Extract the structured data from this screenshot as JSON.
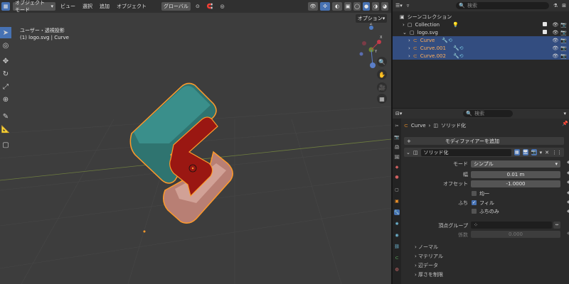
{
  "viewport": {
    "mode": "オブジェクトモード",
    "menus": [
      "ビュー",
      "選択",
      "追加",
      "オブジェクト"
    ],
    "transform": "グローバル",
    "options_label": "オプション",
    "view_name": "ユーザー・透視投影",
    "collection_info": "(1) logo.svg | Curve",
    "gizmo_axes": {
      "x": "X",
      "y": "Y",
      "z": "Z"
    }
  },
  "outliner": {
    "search_placeholder": "検索",
    "scene_collection": "シーンコレクション",
    "rows": [
      {
        "name": "Collection",
        "depth": 1,
        "highlight": false,
        "orange": false
      },
      {
        "name": "logo.svg",
        "depth": 1,
        "highlight": false,
        "orange": false
      },
      {
        "name": "Curve",
        "depth": 2,
        "highlight": true,
        "orange": true
      },
      {
        "name": "Curve.001",
        "depth": 2,
        "highlight": true,
        "orange": true
      },
      {
        "name": "Curve.002",
        "depth": 2,
        "highlight": true,
        "orange": true
      }
    ]
  },
  "properties": {
    "search_placeholder": "検索",
    "breadcrumb": {
      "object": "Curve",
      "modifier": "ソリッド化"
    },
    "add_modifier": "モディファイアーを追加",
    "modifier_name": "ソリッド化",
    "mode_label": "モード",
    "mode_value": "シンプル",
    "width_label": "幅",
    "width_value": "0.01 m",
    "offset_label": "オフセット",
    "offset_value": "-1.0000",
    "even_label": "均一",
    "rim_label": "ふち",
    "fill_label": "フィル",
    "rim_only_label": "ふちのみ",
    "vgroup_label": "頂点グループ",
    "factor_label": "係数",
    "factor_value": "0.000",
    "subpanels": [
      "ノーマル",
      "マテリアル",
      "辺データ",
      "厚さを制限"
    ],
    "fill_checked": true,
    "even_checked": false,
    "rim_only_checked": false
  },
  "colors": {
    "accent": "#4772b3",
    "teal": "#3a8c88",
    "red": "#9a1712",
    "salmon": "#c38f83",
    "outline": "#ff9a2a"
  }
}
